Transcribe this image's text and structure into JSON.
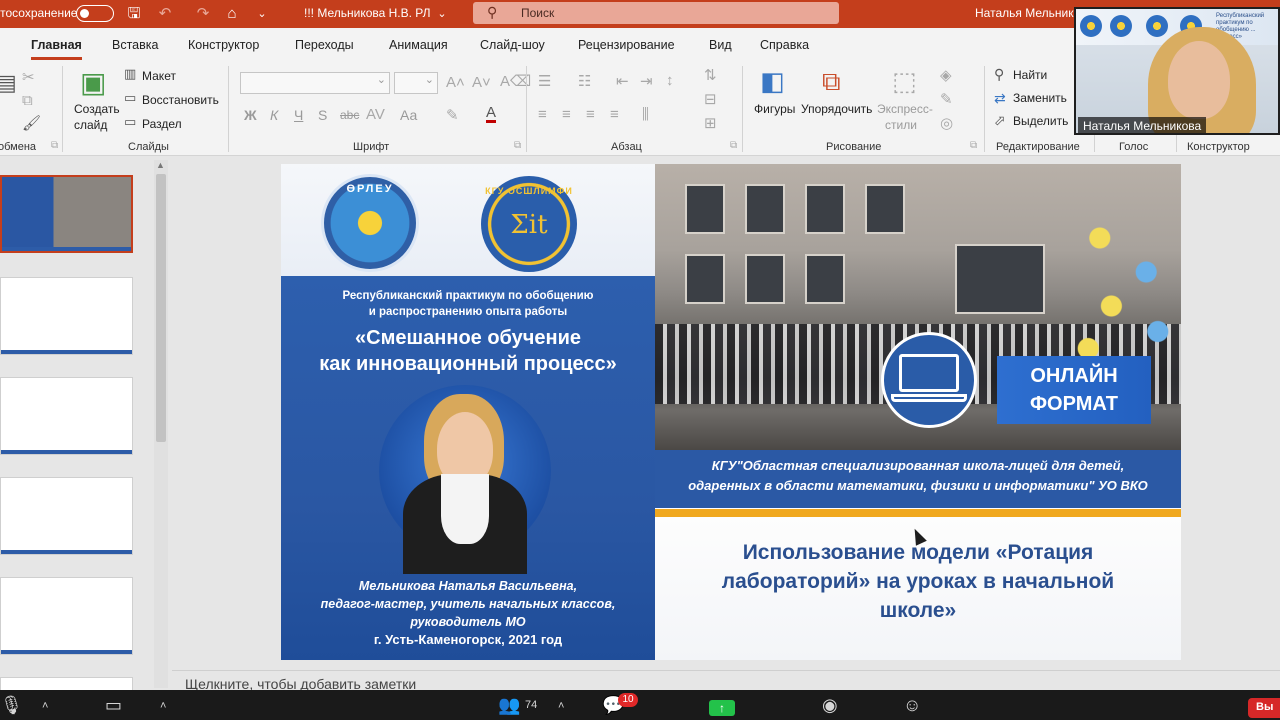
{
  "titlebar": {
    "autosave_label": "Автосохранение",
    "document_title": "!!! Мельникова Н.В. РЛ",
    "search_placeholder": "Поиск",
    "user_name": "Наталья Мельник"
  },
  "ribbon_tabs": [
    {
      "label": "Главная",
      "active": true
    },
    {
      "label": "Вставка"
    },
    {
      "label": "Конструктор"
    },
    {
      "label": "Переходы"
    },
    {
      "label": "Анимация"
    },
    {
      "label": "Слайд-шоу"
    },
    {
      "label": "Рецензирование"
    },
    {
      "label": "Вид"
    },
    {
      "label": "Справка"
    }
  ],
  "ribbon": {
    "clipboard_group": "обмена",
    "slides_group": "Слайды",
    "create_slide": "Создать",
    "create_slide2": "слайд",
    "layout": "Макет",
    "reset": "Восстановить",
    "section": "Раздел",
    "font_group": "Шрифт",
    "paragraph_group": "Абзац",
    "shapes": "Фигуры",
    "arrange": "Упорядочить",
    "quick_styles": "Экспресс-",
    "quick_styles2": "стили",
    "drawing_group": "Рисование",
    "find": "Найти",
    "replace": "Заменить",
    "select": "Выделить",
    "editing_group": "Редактирование",
    "voice_group": "Голос",
    "designer_group": "Конструктор",
    "bold": "Ж",
    "italic": "К",
    "underline": "Ч",
    "shadow": "S",
    "strike": "abc",
    "case": "Аа"
  },
  "slide": {
    "logo1_text": "ӨРЛЕУ",
    "logo2_text": "Σit",
    "logo2_ring": "КГУ ОСШЛИМФИ",
    "practicum": "Республиканский практикум по обобщению\nи распространению опыта работы",
    "main_title": "«Смешанное обучение\nкак инновационный процесс»",
    "author": "Мельникова Наталья Васильевна,\nпедагог-мастер, учитель начальных классов,\nруководитель МО",
    "city": "г. Усть-Каменогорск, 2021 год",
    "online": "ОНЛАЙН\nФОРМАТ",
    "school": "КГУ\"Областная специализированная школа-лицей для детей,\nодаренных в области математики, физики и информатики\" УО ВКО",
    "topic": "Использование модели «Ротация\nлабораторий» на уроках в начальной\nшколе»"
  },
  "notes_placeholder": "Щелкните, чтобы добавить заметки",
  "video": {
    "participant_name": "Наталья Мельникова",
    "banner_text": "Республиканский практикум по обобщению ... процесс»"
  },
  "zoom": {
    "participants_count": "74",
    "chat_badge": "10",
    "leave_label": "Вы"
  }
}
